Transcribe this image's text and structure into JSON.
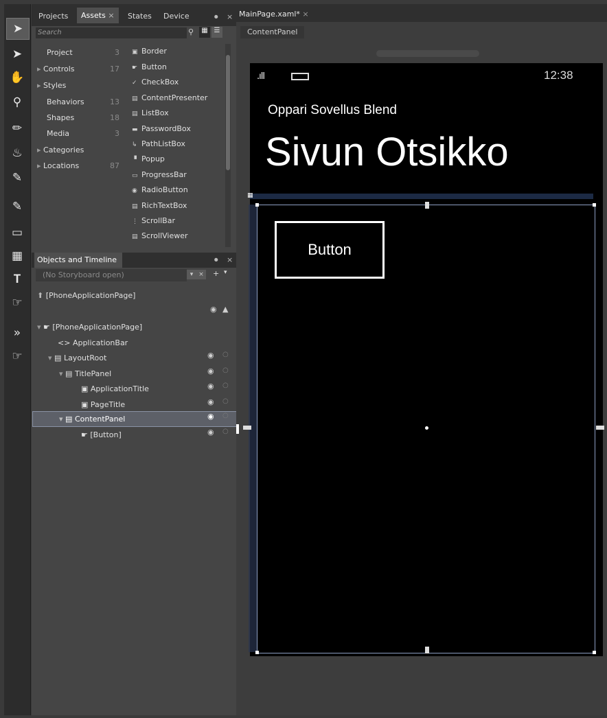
{
  "assets_panel": {
    "tabs": [
      "Projects",
      "Assets",
      "States",
      "Device"
    ],
    "active_tab": "Assets",
    "search_placeholder": "Search",
    "categories": [
      {
        "label": "Project",
        "count": "3",
        "expandable": false
      },
      {
        "label": "Controls",
        "count": "17",
        "expandable": true
      },
      {
        "label": "Styles",
        "count": "",
        "expandable": true
      },
      {
        "label": "Behaviors",
        "count": "13",
        "expandable": false
      },
      {
        "label": "Shapes",
        "count": "18",
        "expandable": false
      },
      {
        "label": "Media",
        "count": "3",
        "expandable": false
      },
      {
        "label": "Categories",
        "count": "",
        "expandable": true
      },
      {
        "label": "Locations",
        "count": "87",
        "expandable": true
      }
    ],
    "assets": [
      "Border",
      "Button",
      "CheckBox",
      "ContentPresenter",
      "ListBox",
      "PasswordBox",
      "PathListBox",
      "Popup",
      "ProgressBar",
      "RadioButton",
      "RichTextBox",
      "ScrollBar",
      "ScrollViewer"
    ]
  },
  "objects_panel": {
    "title": "Objects and Timeline",
    "storyboard": "(No Storyboard open)",
    "root_page": "[PhoneApplicationPage]",
    "tree": [
      "[PhoneApplicationPage]",
      "ApplicationBar",
      "LayoutRoot",
      "TitlePanel",
      "ApplicationTitle",
      "PageTitle",
      "ContentPanel",
      "[Button]"
    ],
    "selected": "ContentPanel"
  },
  "design": {
    "doc_tab": "MainPage.xaml*",
    "breadcrumb": "ContentPanel",
    "clock": "12:38",
    "app_title": "Oppari Sovellus Blend",
    "page_title": "Sivun Otsikko",
    "button_label": "Button"
  }
}
